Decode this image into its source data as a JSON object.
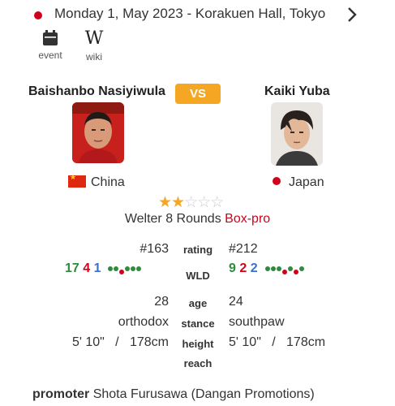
{
  "event": {
    "date_venue": "Monday 1, May 2023  -  Korakuen Hall, Tokyo",
    "event_label": "event",
    "wiki_label": "wiki",
    "wiki_glyph": "W"
  },
  "fighters": {
    "a": {
      "name": "Baishanbo Nasiyiwula",
      "country": "China"
    },
    "b": {
      "name": "Kaiki Yuba",
      "country": "Japan"
    },
    "vs_label": "VS"
  },
  "bout": {
    "stars_filled": 2,
    "stars_total": 5,
    "description": "Welter 8 Rounds",
    "type": "Box-pro"
  },
  "stats": {
    "rating": {
      "label": "rating",
      "a": "#163",
      "b": "#212"
    },
    "wld": {
      "label": "WLD",
      "a": {
        "w": "17",
        "l": "4",
        "d": "1"
      },
      "b": {
        "w": "9",
        "l": "2",
        "d": "2"
      }
    },
    "age": {
      "label": "age",
      "a": "28",
      "b": "24"
    },
    "stance": {
      "label": "stance",
      "a": "orthodox",
      "b": "southpaw"
    },
    "height": {
      "label": "height",
      "a_ft": "5' 10\"",
      "a_cm": "178cm",
      "b_ft": "5' 10\"",
      "b_cm": "178cm",
      "sep": "/"
    },
    "reach": {
      "label": "reach"
    }
  },
  "recent_results": {
    "a": [
      "W",
      "W",
      "L",
      "W",
      "W",
      "W"
    ],
    "b": [
      "W",
      "W",
      "W",
      "L",
      "W",
      "L",
      "W"
    ]
  },
  "promoter": {
    "label": "promoter",
    "value": "Shota Furusawa (Dangan Promotions)"
  },
  "colors": {
    "accent": "#f5a623",
    "red": "#d0021b",
    "win": "#2e8b3e",
    "draw": "#3b6fd1"
  }
}
